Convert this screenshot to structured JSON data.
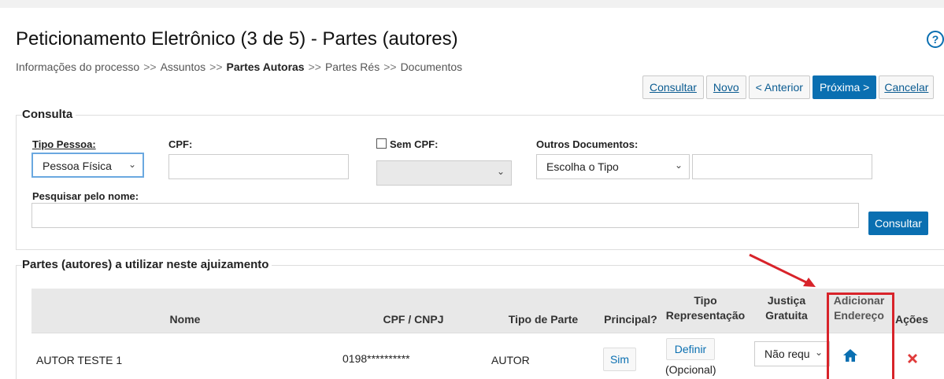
{
  "header": {
    "title": "Peticionamento Eletrônico (3 de 5) - Partes (autores)",
    "help_icon": "?",
    "breadcrumb": [
      {
        "label": "Informações do processo",
        "current": false
      },
      {
        "label": "Assuntos",
        "current": false
      },
      {
        "label": "Partes Autoras",
        "current": true
      },
      {
        "label": "Partes Rés",
        "current": false
      },
      {
        "label": "Documentos",
        "current": false
      }
    ],
    "breadcrumb_sep": ">>"
  },
  "toolbar": {
    "consultar": "Consultar",
    "novo": "Novo",
    "anterior": "< Anterior",
    "proxima": "Próxima >",
    "cancelar": "Cancelar"
  },
  "consulta": {
    "legend": "Consulta",
    "tipo_pessoa_label": "Tipo Pessoa:",
    "tipo_pessoa_value": "Pessoa Física",
    "cpf_label": "CPF:",
    "cpf_value": "",
    "sem_cpf_label": "Sem CPF:",
    "sem_cpf_value": "",
    "outros_label": "Outros Documentos:",
    "outros_value": "Escolha o Tipo",
    "outros_input": "",
    "nome_label": "Pesquisar pelo nome:",
    "nome_value": "",
    "consultar_button": "Consultar"
  },
  "partes": {
    "legend": "Partes (autores) a utilizar neste ajuizamento",
    "columns": {
      "nome": "Nome",
      "cpf": "CPF / CNPJ",
      "tipo": "Tipo de Parte",
      "principal": "Principal?",
      "representacao": [
        "Tipo",
        "Representação"
      ],
      "justica": [
        "Justiça",
        "Gratuita"
      ],
      "endereco": [
        "Adicionar",
        "Endereço"
      ],
      "acoes": "Ações"
    },
    "rows": [
      {
        "nome": "AUTOR TESTE 1",
        "cpf": "0198**********",
        "tipo": "AUTOR",
        "principal": "Sim",
        "definir": "Definir",
        "opcional": "(Opcional)",
        "justica": "Não requ",
        "endereco_icon": "home-icon",
        "acao_icon": "delete-icon"
      }
    ]
  },
  "colors": {
    "primary": "#0a6fb1",
    "highlight": "#d8232a",
    "delete": "#e03a3a"
  }
}
